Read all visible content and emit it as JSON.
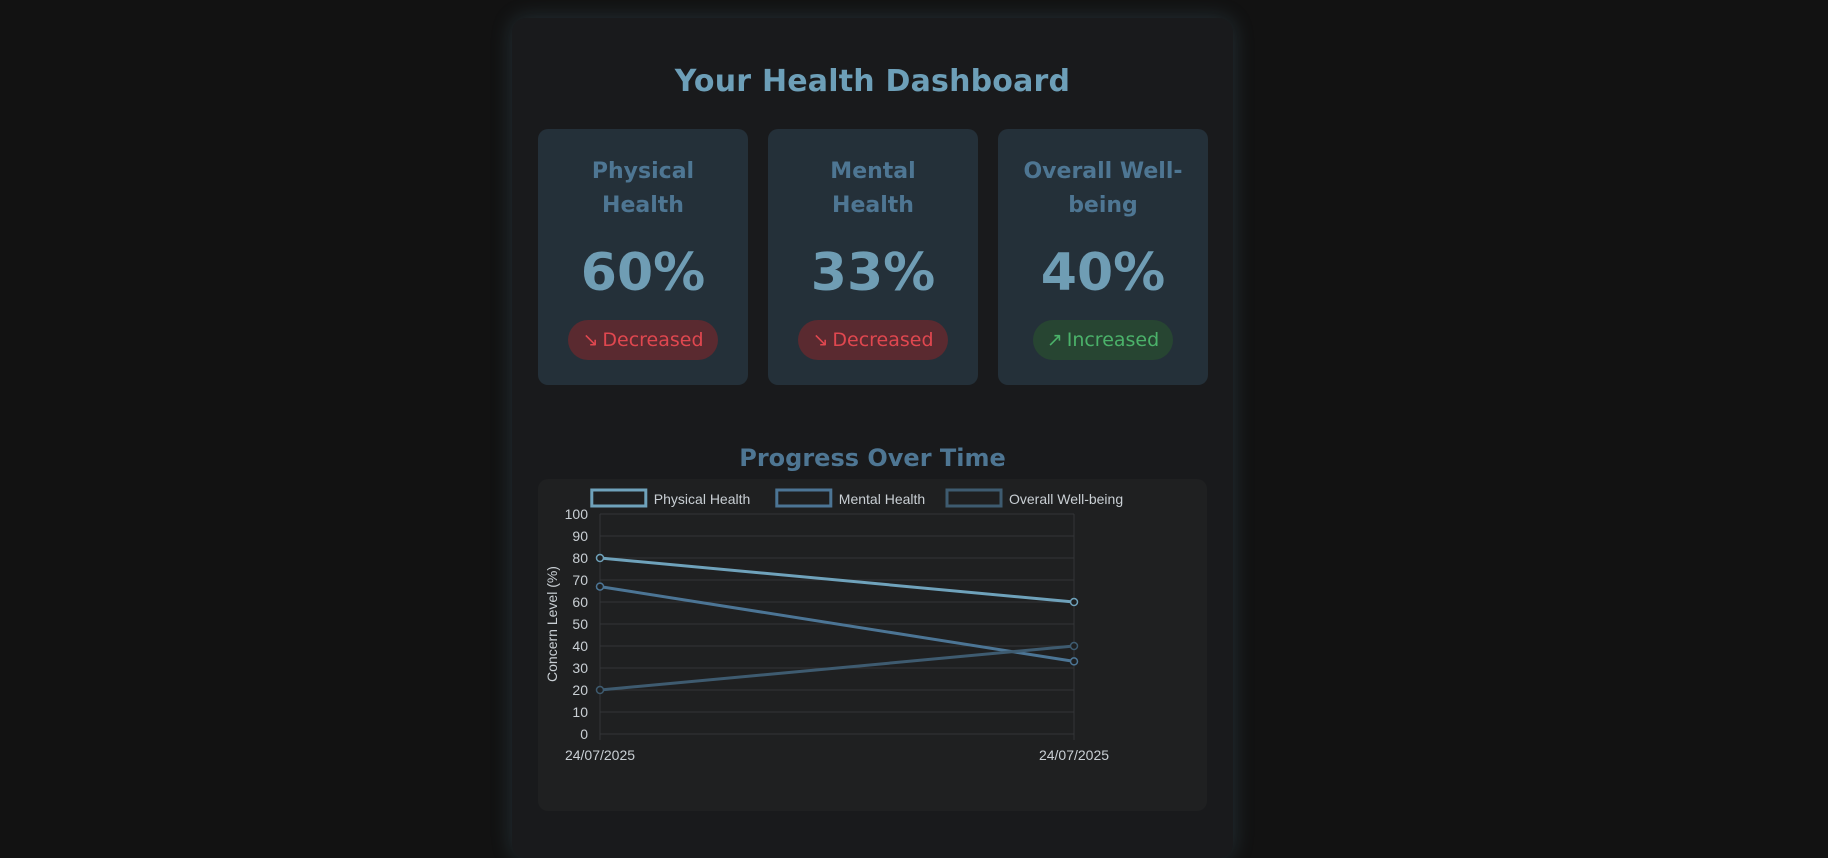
{
  "title": "Your Health Dashboard",
  "cards": [
    {
      "title": "Physical Health",
      "value": "60%",
      "status": "Decreased",
      "arrow": "↘",
      "trend": "down"
    },
    {
      "title": "Mental Health",
      "value": "33%",
      "status": "Decreased",
      "arrow": "↘",
      "trend": "down"
    },
    {
      "title": "Overall Well-being",
      "value": "40%",
      "status": "Increased",
      "arrow": "↗",
      "trend": "up"
    }
  ],
  "chart_section_title": "Progress Over Time",
  "colors": {
    "physical": "#6fa2bb",
    "mental": "#4c7595",
    "overall": "#3e5b70",
    "decreased": "#e0474f",
    "increased": "#4bb26a"
  },
  "chart_data": {
    "type": "line",
    "x": [
      "24/07/2025",
      "24/07/2025"
    ],
    "series": [
      {
        "name": "Physical Health",
        "values": [
          80,
          60
        ]
      },
      {
        "name": "Mental Health",
        "values": [
          67,
          33
        ]
      },
      {
        "name": "Overall Well-being",
        "values": [
          20,
          40
        ]
      }
    ],
    "title": "",
    "xlabel": "",
    "ylabel": "Concern Level (%)",
    "ylim": [
      0,
      100
    ],
    "yticks": [
      0,
      10,
      20,
      30,
      40,
      50,
      60,
      70,
      80,
      90,
      100
    ],
    "grid": true,
    "legend": "top"
  }
}
